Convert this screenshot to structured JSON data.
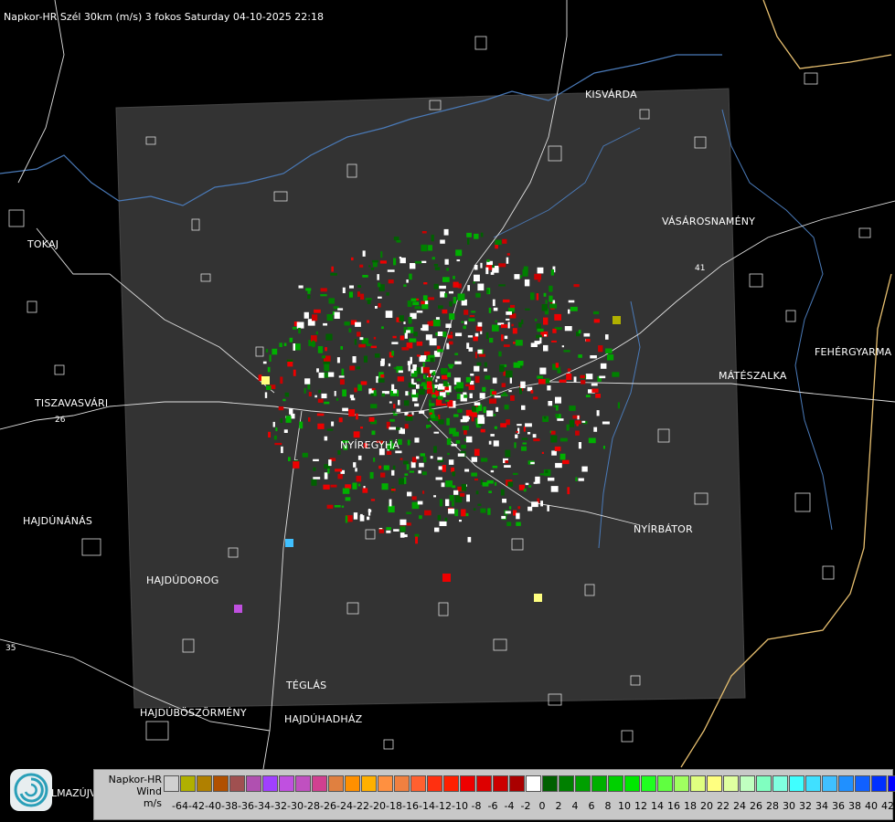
{
  "title": "Napkor-HR Szél 30km (m/s) 3 fokos Saturday 04-10-2025 22:18",
  "cities": [
    {
      "id": "kisvarda",
      "name": "KISVÁRDA"
    },
    {
      "id": "tokaj",
      "name": "TOKAJ"
    },
    {
      "id": "vasarosnameny",
      "name": "VÁSÁROSNAMÉNY"
    },
    {
      "id": "fehergyarmat",
      "name": "FEHÉRGYARMA"
    },
    {
      "id": "mateszalka",
      "name": "MÁTÉSZALKA"
    },
    {
      "id": "tiszavasvari",
      "name": "TISZAVASVÁRI"
    },
    {
      "id": "nyiregyhaza",
      "name": "NYÍREGYHÁ"
    },
    {
      "id": "hajdunanas",
      "name": "HAJDÚNÁNÁS"
    },
    {
      "id": "nyirbator",
      "name": "NYÍRBÁTOR"
    },
    {
      "id": "hajdudorog",
      "name": "HAJDÚDOROG"
    },
    {
      "id": "teglas",
      "name": "TÉGLÁS"
    },
    {
      "id": "hajduboszormeny",
      "name": "HAJDÚBÖSZÖRMÉNY"
    },
    {
      "id": "hajduhadhaz",
      "name": "HAJDÚHADHÁZ"
    }
  ],
  "road_numbers": [
    "26",
    "35",
    "41"
  ],
  "logo_label": "LMAZÚJVÁR",
  "legend": {
    "title_lines": [
      "Napkor-HR",
      "Wind",
      "m/s"
    ],
    "colors": [
      "#d0d0d0",
      "#b0b000",
      "#b08000",
      "#b05000",
      "#a05050",
      "#b050b0",
      "#a040ff",
      "#c050e0",
      "#c050c0",
      "#d04090",
      "#e08040",
      "#ff9000",
      "#ffb000",
      "#ff9040",
      "#f08040",
      "#ff6030",
      "#ff3010",
      "#ff2000",
      "#ee0000",
      "#dd0000",
      "#cc0000",
      "#aa0000",
      "#ffffff",
      "#006000",
      "#008000",
      "#00a000",
      "#00b000",
      "#00d000",
      "#00e800",
      "#20ff20",
      "#60ff40",
      "#a0ff60",
      "#e0ff80",
      "#ffff80",
      "#e0ffa0",
      "#c0ffc0",
      "#80ffc0",
      "#80ffe0",
      "#40ffff",
      "#40e0ff",
      "#40c0ff",
      "#2090ff",
      "#1060ff",
      "#0030ff",
      "#0000ff"
    ],
    "tick_labels": [
      "-64",
      "-42",
      "-40",
      "-38",
      "-36",
      "-34",
      "-32",
      "-30",
      "-28",
      "-26",
      "-24",
      "-22",
      "-20",
      "-18",
      "-16",
      "-14",
      "-12",
      "-10",
      "-8",
      "-6",
      "-4",
      "-2",
      "0",
      "2",
      "4",
      "6",
      "8",
      "10",
      "12",
      "14",
      "16",
      "18",
      "20",
      "22",
      "24",
      "26",
      "28",
      "30",
      "32",
      "34",
      "36",
      "38",
      "40",
      "42"
    ]
  }
}
